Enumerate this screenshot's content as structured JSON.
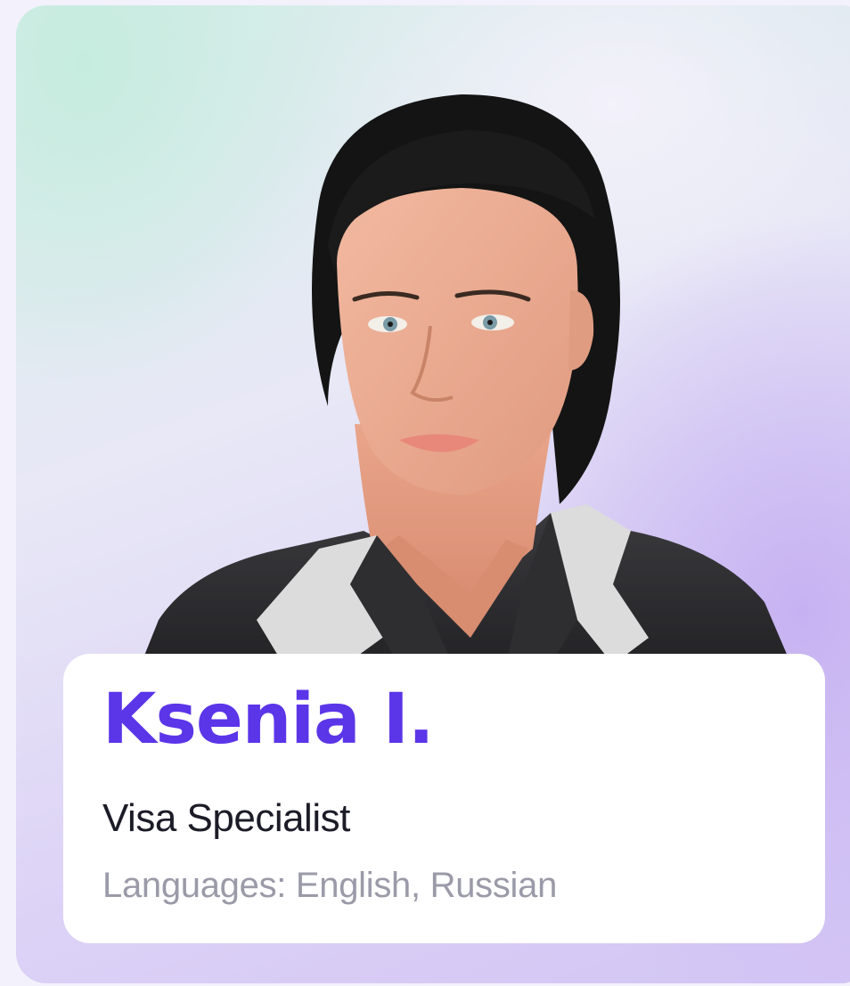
{
  "profile": {
    "name": "Ksenia I.",
    "role": "Visa Specialist",
    "languages": "Languages: English, Russian"
  },
  "colors": {
    "name_accent": "#5b35e8",
    "role_text": "#1c1c28",
    "languages_text": "#9a9aa8",
    "panel_background": "#ffffff"
  },
  "icons": {
    "portrait": "specialist-portrait-photo"
  }
}
